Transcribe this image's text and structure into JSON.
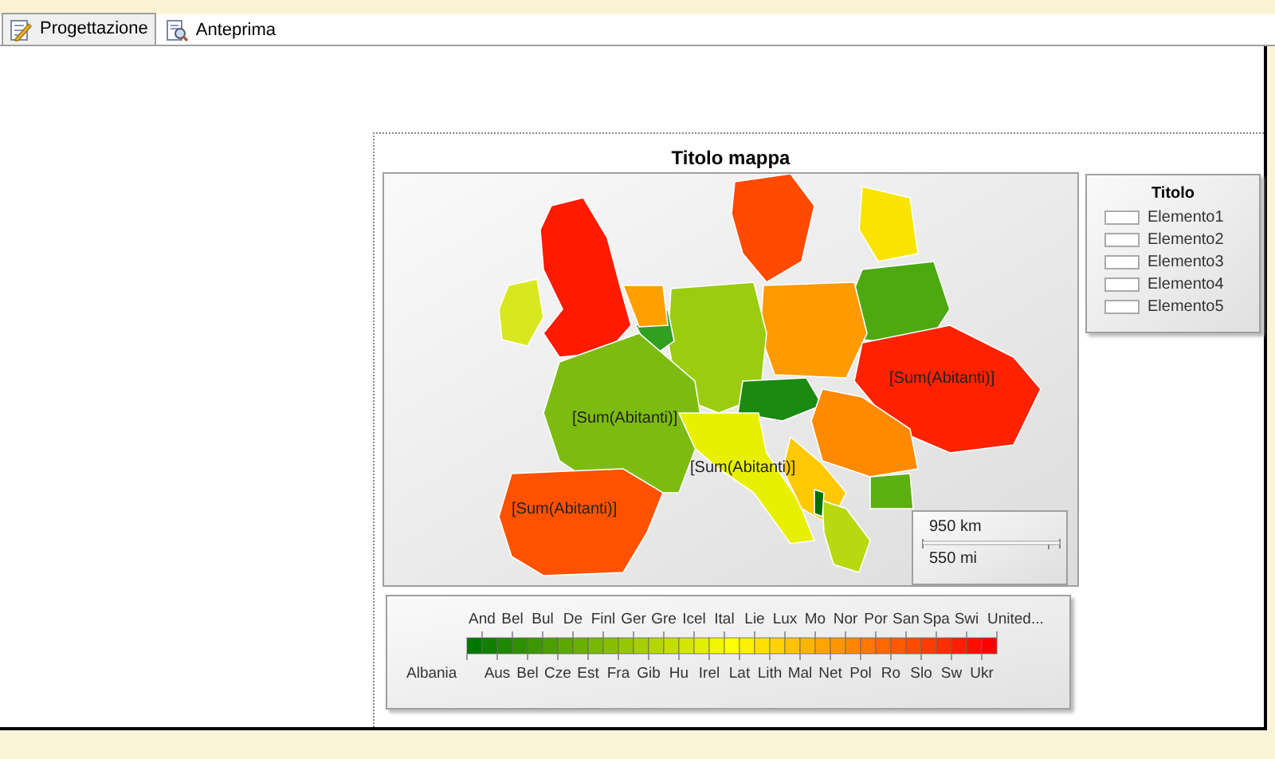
{
  "tabs": [
    {
      "label": "Progettazione",
      "selected": true
    },
    {
      "label": "Anteprima",
      "selected": false
    }
  ],
  "map": {
    "title": "Titolo mappa",
    "data_labels": [
      "[Sum(Abitanti)]",
      "[Sum(Abitanti)]",
      "[Sum(Abitanti)]",
      "[Sum(Abitanti)]"
    ],
    "scale": {
      "top": "950 km",
      "bottom": "550 mi"
    }
  },
  "legend": {
    "title": "Titolo",
    "items": [
      "Elemento1",
      "Elemento2",
      "Elemento3",
      "Elemento4",
      "Elemento5"
    ]
  },
  "color_scale": {
    "labels": [
      "Albania",
      "And",
      "Aus",
      "Bel",
      "Bel",
      "Bul",
      "Cze",
      "De",
      "Est",
      "Finl",
      "Fra",
      "Ger",
      "Gib",
      "Gre",
      "Hu",
      "Icel",
      "Irel",
      "Ital",
      "Lat",
      "Lie",
      "Lith",
      "Lux",
      "Mal",
      "Mo",
      "Net",
      "Nor",
      "Pol",
      "Por",
      "Ro",
      "San",
      "Slo",
      "Spa",
      "Sw",
      "Swi",
      "Ukr",
      "United..."
    ]
  }
}
